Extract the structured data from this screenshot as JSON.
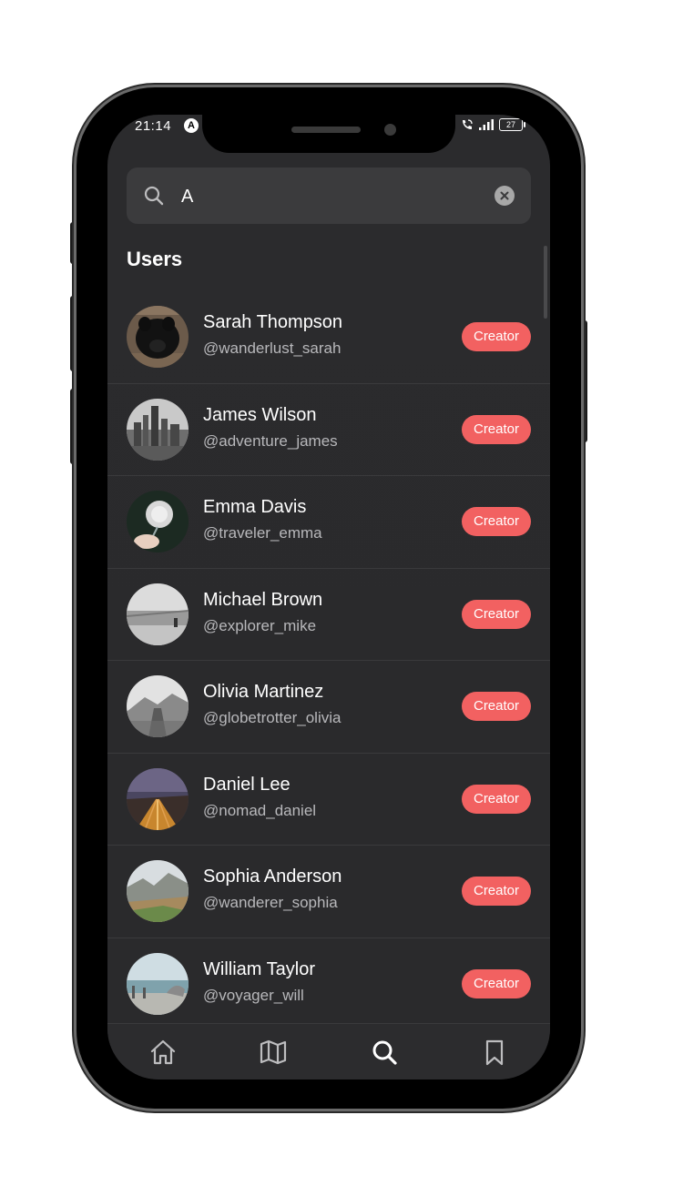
{
  "status_bar": {
    "time": "21:14",
    "app_indicator": "A",
    "battery": "27",
    "icons": [
      "call-wifi-icon",
      "signal-icon",
      "battery-icon"
    ]
  },
  "search": {
    "value": "A",
    "placeholder": "Search"
  },
  "section_title": "Users",
  "users": [
    {
      "name": "Sarah Thompson",
      "handle": "@wanderlust_sarah",
      "badge": "Creator"
    },
    {
      "name": "James Wilson",
      "handle": "@adventure_james",
      "badge": "Creator"
    },
    {
      "name": "Emma Davis",
      "handle": "@traveler_emma",
      "badge": "Creator"
    },
    {
      "name": "Michael Brown",
      "handle": "@explorer_mike",
      "badge": "Creator"
    },
    {
      "name": "Olivia Martinez",
      "handle": "@globetrotter_olivia",
      "badge": "Creator"
    },
    {
      "name": "Daniel Lee",
      "handle": "@nomad_daniel",
      "badge": "Creator"
    },
    {
      "name": "Sophia Anderson",
      "handle": "@wanderer_sophia",
      "badge": "Creator"
    },
    {
      "name": "William Taylor",
      "handle": "@voyager_will",
      "badge": "Creator"
    }
  ],
  "nav": {
    "items": [
      "home-icon",
      "map-icon",
      "search-icon",
      "bookmark-icon"
    ],
    "active": "search-icon"
  },
  "colors": {
    "background": "#2b2b2d",
    "search_bg": "#3b3b3d",
    "badge": "#f26161",
    "handle_text": "#b8b8bb"
  }
}
